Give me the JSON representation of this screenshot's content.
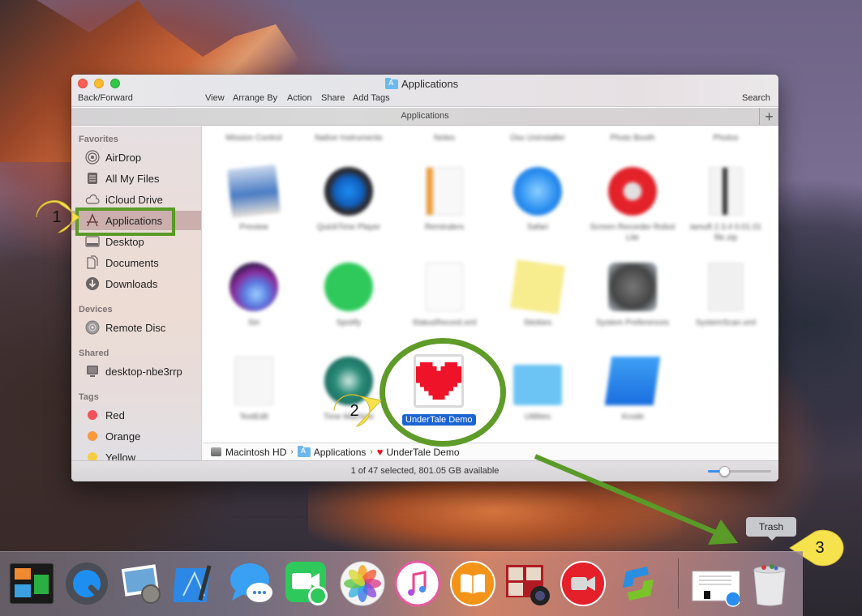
{
  "window": {
    "title": "Applications",
    "toolbar": {
      "back_forward": "Back/Forward",
      "view": "View",
      "arrange_by": "Arrange By",
      "action": "Action",
      "share": "Share",
      "add_tags": "Add Tags",
      "search": "Search"
    },
    "path_title": "Applications",
    "add_tab_label": "+"
  },
  "sidebar": {
    "sections": [
      {
        "label": "Favorites",
        "items": [
          {
            "label": "AirDrop",
            "icon": "airdrop-icon"
          },
          {
            "label": "All My Files",
            "icon": "all-files-icon"
          },
          {
            "label": "iCloud Drive",
            "icon": "cloud-icon"
          },
          {
            "label": "Applications",
            "icon": "applications-icon",
            "selected": true
          },
          {
            "label": "Desktop",
            "icon": "desktop-icon"
          },
          {
            "label": "Documents",
            "icon": "documents-icon"
          },
          {
            "label": "Downloads",
            "icon": "downloads-icon"
          }
        ]
      },
      {
        "label": "Devices",
        "items": [
          {
            "label": "Remote Disc",
            "icon": "disc-icon"
          }
        ]
      },
      {
        "label": "Shared",
        "items": [
          {
            "label": "desktop-nbe3rrp",
            "icon": "computer-icon"
          }
        ]
      },
      {
        "label": "Tags",
        "items": [
          {
            "label": "Red",
            "color": "#f4525a"
          },
          {
            "label": "Orange",
            "color": "#f89a3c"
          },
          {
            "label": "Yellow",
            "color": "#f7cd45"
          }
        ]
      }
    ]
  },
  "content": {
    "row0": [
      "Mission Control",
      "Native Instruments",
      "Notes",
      "Osx Uninstaller",
      "Photo Booth",
      "Photos"
    ],
    "row1": [
      "Preview",
      "QuickTime Player",
      "Reminders",
      "Safari",
      "Screen Recorder Robot Lite",
      "iamuft 2.3.4 0.01.01 file.zip"
    ],
    "row2": [
      "Siri",
      "Spotify",
      "StatusRecord.xml",
      "Stickies",
      "System Preferences",
      "SystemScan.xml"
    ],
    "row3": [
      "TextEdit",
      "Time Machine",
      "UnderTale Demo",
      "Utilities",
      "Xcode"
    ],
    "selected_item": "UnderTale Demo"
  },
  "breadcrumb": {
    "items": [
      "Macintosh HD",
      "Applications",
      "UnderTale Demo"
    ],
    "separator": "›"
  },
  "status": {
    "text": "1 of 47 selected, 801.05 GB available",
    "icon_size_slider": 0.25
  },
  "annotations": {
    "callout_1": "1",
    "callout_2": "2",
    "callout_3": "3",
    "highlight_color": "#5a9a28",
    "callout_color": "#f5e04a"
  },
  "dock": {
    "items": [
      "Mission Control",
      "QuickTime Player",
      "Preview",
      "Xcode",
      "Messages",
      "FaceTime",
      "Photos",
      "iTunes",
      "iBooks",
      "Photo Booth",
      "Screen Recorder Robot Lite",
      "Snagit"
    ],
    "tray": [
      "Safari Document",
      "Trash"
    ],
    "tooltip": "Trash"
  }
}
